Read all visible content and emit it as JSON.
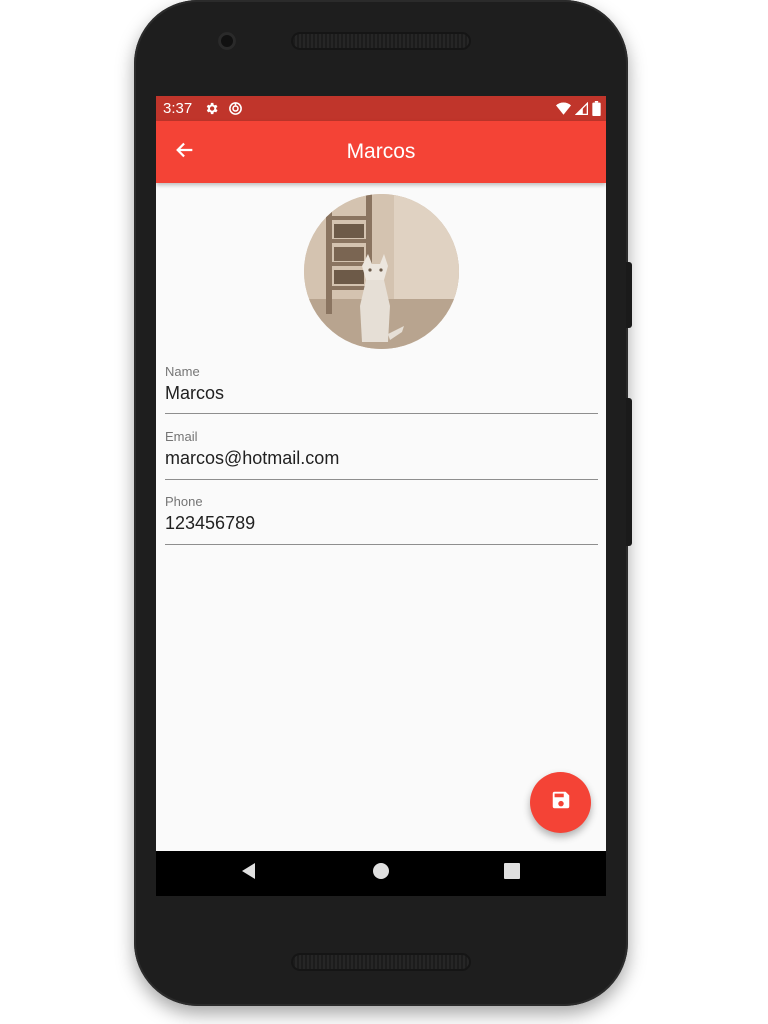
{
  "status_bar": {
    "time": "3:37",
    "icons": [
      "settings-icon",
      "sync-icon",
      "wifi-icon",
      "signal-icon",
      "battery-icon"
    ]
  },
  "app_bar": {
    "title": "Marcos",
    "back_icon": "arrow-left-icon",
    "color": "#f44336"
  },
  "profile": {
    "avatar_icon": "cat-photo"
  },
  "form": {
    "name": {
      "label": "Name",
      "value": "Marcos"
    },
    "email": {
      "label": "Email",
      "value": "marcos@hotmail.com"
    },
    "phone": {
      "label": "Phone",
      "value": "123456789"
    }
  },
  "fab": {
    "icon": "save-icon",
    "color": "#f44336"
  },
  "nav_bar": {
    "icons": [
      "back-triangle-icon",
      "home-circle-icon",
      "recents-square-icon"
    ]
  }
}
